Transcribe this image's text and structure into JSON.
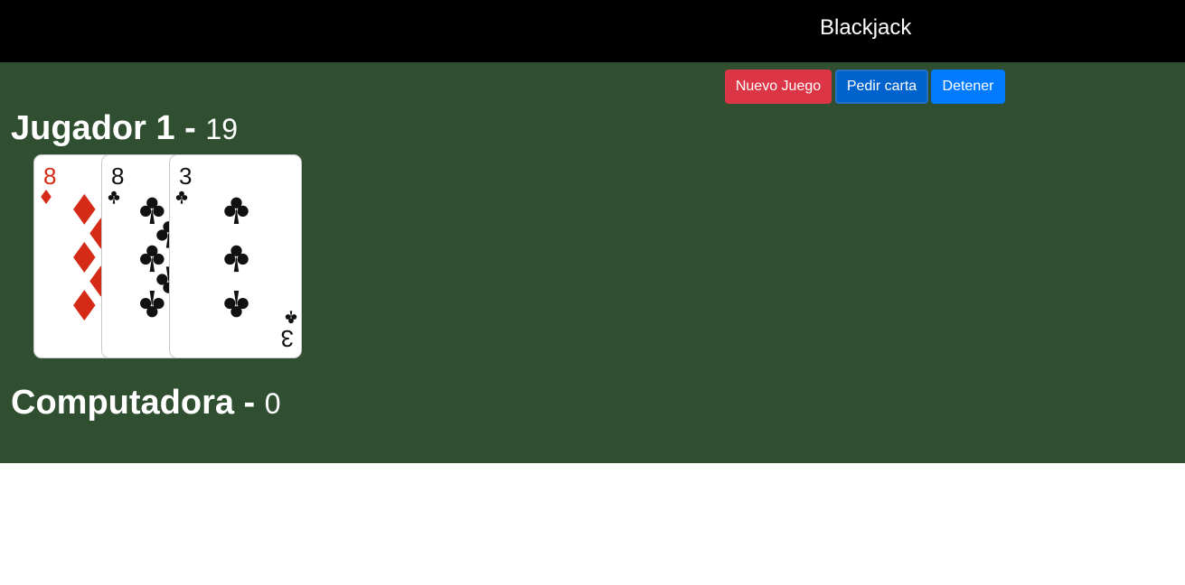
{
  "header": {
    "title": "Blackjack"
  },
  "controls": {
    "new_game": "Nuevo Juego",
    "hit": "Pedir carta",
    "stand": "Detener"
  },
  "player": {
    "name": "Jugador 1",
    "separator": " - ",
    "score": "19",
    "cards": [
      {
        "rank": "8",
        "suit": "diamonds",
        "color": "#d42a16"
      },
      {
        "rank": "8",
        "suit": "clubs",
        "color": "#111111"
      },
      {
        "rank": "3",
        "suit": "clubs",
        "color": "#111111"
      }
    ]
  },
  "computer": {
    "name": "Computadora",
    "separator": " - ",
    "score": "0",
    "cards": []
  },
  "colors": {
    "felt": "#304f31",
    "topbar": "#000000",
    "danger": "#dc3545",
    "primary": "#007bff"
  }
}
